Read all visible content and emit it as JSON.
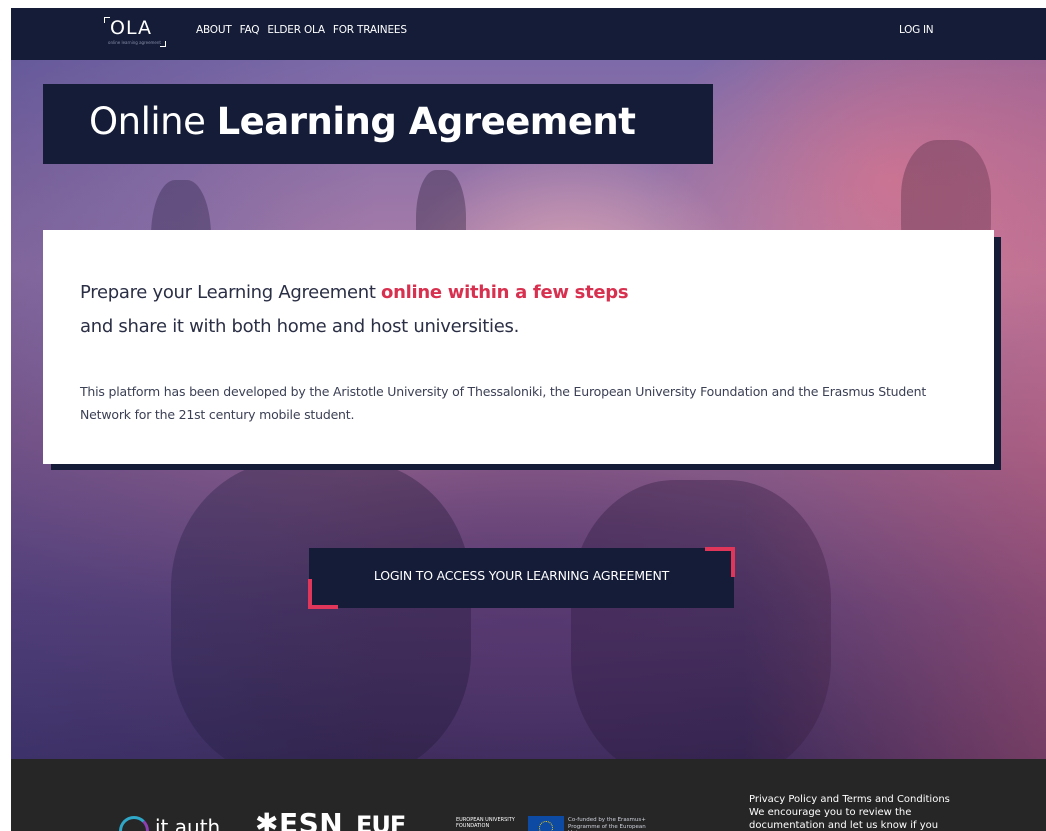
{
  "logo": {
    "text": "OLA",
    "subtitle": "online learning agreement"
  },
  "nav": {
    "links": [
      "ABOUT",
      "FAQ",
      "ELDER OLA",
      "FOR TRAINEES"
    ],
    "login": "LOG IN"
  },
  "hero": {
    "title_light": "Online ",
    "title_bold": "Learning Agreement",
    "intro_line1_start": "Prepare your Learning Agreement ",
    "intro_line1_highlight": "online within a few steps",
    "intro_line2": "and share it with both home and host universities.",
    "description": "This platform has been developed by the Aristotle University of Thessaloniki, the European University Foundation and the Erasmus Student Network for the 21st century mobile student.",
    "cta": "LOGIN TO ACCESS YOUR LEARNING AGREEMENT"
  },
  "footer": {
    "partners": {
      "itauth": "it.auth",
      "esn": "✱ESN",
      "euf_mark": "EUF",
      "euf_text": "EUROPEAN UNIVERSITY FOUNDATION",
      "eu_text": "Co-funded by the Erasmus+ Programme of the European Union"
    },
    "privacy_lines": [
      "Privacy Policy and Terms and Conditions",
      "We encourage you to review the",
      "documentation and let us know if you"
    ]
  },
  "colors": {
    "navy": "#141c38",
    "accent": "#d8304f",
    "footer": "#262626"
  }
}
